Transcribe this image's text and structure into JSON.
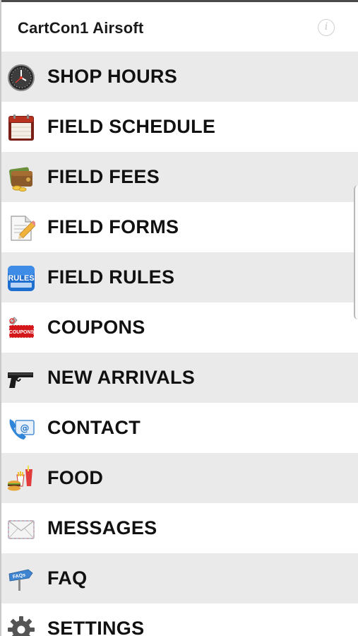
{
  "header": {
    "title": "CartCon1 Airsoft",
    "info_icon_glyph": "i",
    "info_icon": "info-icon"
  },
  "menu": {
    "items": [
      {
        "label": "SHOP HOURS",
        "icon": "clock-icon"
      },
      {
        "label": "FIELD SCHEDULE",
        "icon": "calendar-icon"
      },
      {
        "label": "FIELD FEES",
        "icon": "wallet-icon"
      },
      {
        "label": "FIELD FORMS",
        "icon": "document-pencil-icon"
      },
      {
        "label": "FIELD RULES",
        "icon": "rules-book-icon",
        "icon_text": "RULES"
      },
      {
        "label": "COUPONS",
        "icon": "coupon-icon",
        "icon_text": "COUPONS"
      },
      {
        "label": "NEW ARRIVALS",
        "icon": "pistol-icon"
      },
      {
        "label": "CONTACT",
        "icon": "contact-phone-email-icon"
      },
      {
        "label": "FOOD",
        "icon": "food-icon"
      },
      {
        "label": "MESSAGES",
        "icon": "envelope-icon"
      },
      {
        "label": "FAQ",
        "icon": "faq-sign-icon",
        "icon_text": "FAQs"
      },
      {
        "label": "SETTINGS",
        "icon": "gear-icon"
      }
    ]
  },
  "colors": {
    "row_shaded": "#eaeaea",
    "row_plain": "#ffffff",
    "text": "#111111"
  }
}
